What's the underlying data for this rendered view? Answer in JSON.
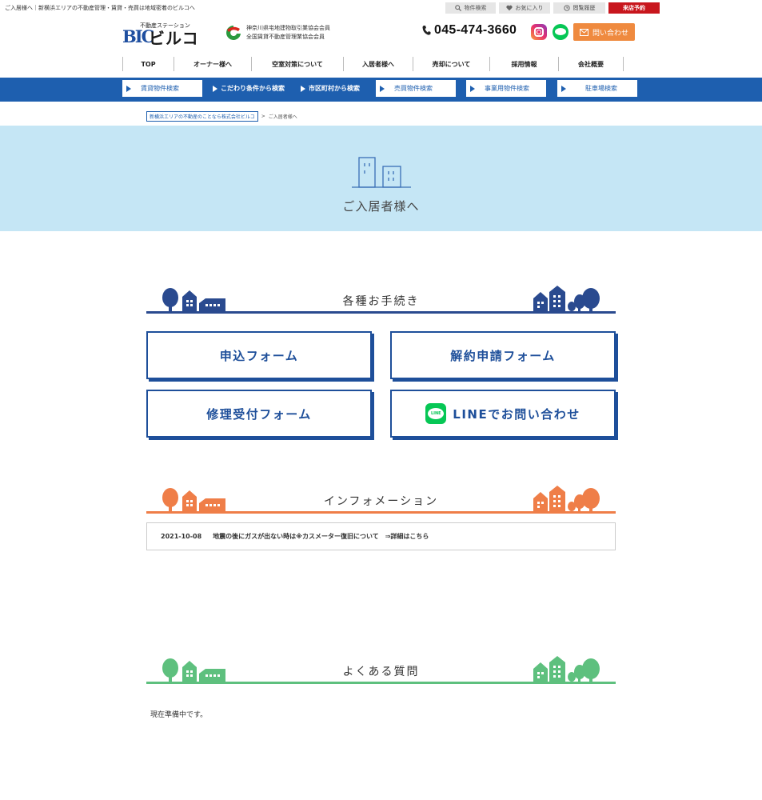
{
  "top": {
    "tagline": "ご入居様へ｜新横浜エリアの不動産管理・賃貸・売買は地域密着のビルコへ",
    "utilities": [
      {
        "label": "物件検索",
        "icon": "search-icon"
      },
      {
        "label": "お気に入り",
        "icon": "heart-icon"
      },
      {
        "label": "閲覧履歴",
        "icon": "clock-icon"
      },
      {
        "label": "来店予約",
        "icon": ""
      }
    ]
  },
  "header": {
    "logo_small": "不動産ステーション",
    "logo_latin": "BIC",
    "logo_kana": "ビルコ",
    "association_lines": [
      "神奈川県宅地建物取引業協会会員",
      "全国賃貸不動産管理業協会会員"
    ],
    "phone": "045-474-3660",
    "contact_label": "問い合わせ"
  },
  "nav": {
    "items": [
      "TOP",
      "オーナー様へ",
      "空室対策について",
      "入居者様へ",
      "売却について",
      "採用情報",
      "会社概要"
    ]
  },
  "search_bar": {
    "items": [
      "賃貸物件検索",
      "こだわり条件から検索",
      "市区町村から検索",
      "売買物件検索",
      "事業用物件検索",
      "駐車場検索"
    ]
  },
  "breadcrumb": {
    "home": "新横浜エリアの不動産のことなら株式会社ビルコ",
    "separator": ">",
    "current": "ご入居者様へ"
  },
  "hero": {
    "title": "ご入居者様へ"
  },
  "procedures": {
    "title": "各種お手続き",
    "buttons": [
      "申込フォーム",
      "解約申請フォーム",
      "修理受付フォーム",
      "LINEでお問い合わせ"
    ],
    "line_badge": "LINE"
  },
  "information": {
    "title": "インフォメーション",
    "date": "2021-10-08",
    "text": "地震の後にガスが出ない時は※カスメーター復旧について　⇒詳細はこちら"
  },
  "faq": {
    "title": "よくある質問",
    "text": "現在準備中です。"
  },
  "colors": {
    "brand_blue": "#1e5faf",
    "navy": "#2a4a8f",
    "orange": "#ef8a3f",
    "green": "#5ec07e",
    "hero_bg": "#c5e6f5",
    "red": "#c8161d"
  }
}
